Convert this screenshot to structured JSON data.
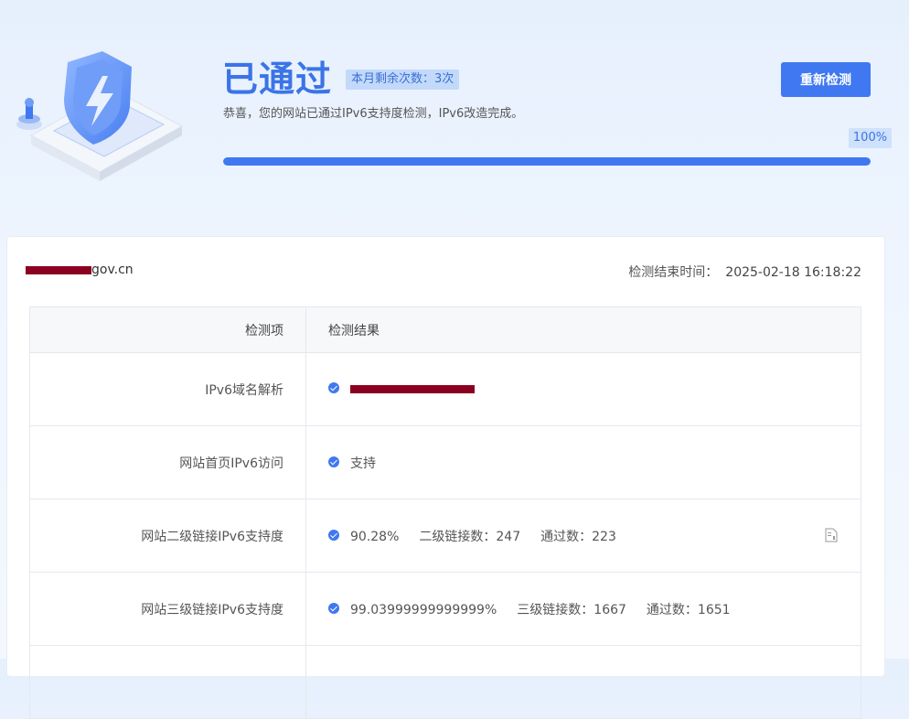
{
  "header": {
    "status_title": "已通过",
    "remaining_label": "本月剩余次数：",
    "remaining_value": "3次",
    "subtitle": "恭喜，您的网站已通过IPv6支持度检测，IPv6改造完成。",
    "recheck_button": "重新检测",
    "progress_text": "100%",
    "progress_percent": 100,
    "icon": "shield-lightning-icon"
  },
  "summary": {
    "domain_suffix": "gov.cn",
    "finish_time_label": "检测结束时间：",
    "finish_time_value": "2025-02-18 16:18:22"
  },
  "table": {
    "headers": [
      "检测项",
      "检测结果"
    ],
    "rows": [
      {
        "item": "IPv6域名解析",
        "result": ""
      },
      {
        "item": "网站首页IPv6访问",
        "result": "支持"
      },
      {
        "item": "网站二级链接IPv6支持度",
        "result": "90.28%",
        "count_label": "二级链接数：",
        "count": "247",
        "pass_label": "通过数：",
        "pass": "223"
      },
      {
        "item": "网站三级链接IPv6支持度",
        "result": "99.03999999999999%",
        "count_label": "三级链接数：",
        "count": "1667",
        "pass_label": "通过数：",
        "pass": "1651"
      }
    ]
  },
  "colors": {
    "accent": "#3f78f0",
    "redaction": "#8b0020"
  }
}
